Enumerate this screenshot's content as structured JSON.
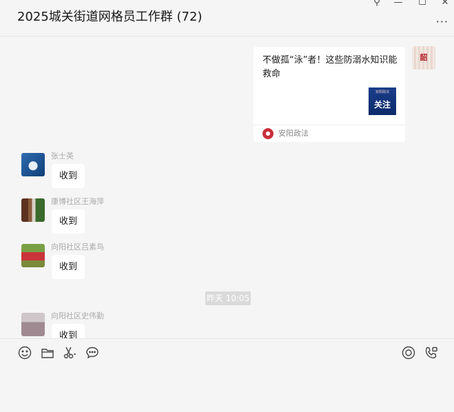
{
  "window": {
    "title": "2025城关街道网格员工作群 (72)",
    "controls": {
      "pin": "⚲",
      "minimize": "—",
      "maximize": "☐",
      "close": "✕"
    },
    "more": "···"
  },
  "article_card": {
    "title": "不做孤“泳”者！这些防溺水知识能救命",
    "thumb_text": "关注",
    "thumb_small": "安阳政法",
    "source": "安阳政法"
  },
  "self_avatar_text": "韶",
  "messages": [
    {
      "sender": "张士英",
      "text": "收到"
    },
    {
      "sender": "康博社区王海萍",
      "text": "收到"
    },
    {
      "sender": "向阳社区吕素鸟",
      "text": "收到"
    },
    {
      "sender": "向阳社区史伟勤",
      "text": "收到"
    }
  ],
  "timestamp": "昨天 10:05",
  "toolbar": {
    "icons": [
      "emoji-icon",
      "folder-icon",
      "scissors-icon",
      "chat-bubble-icon",
      "voice-icon",
      "video-call-icon"
    ]
  }
}
